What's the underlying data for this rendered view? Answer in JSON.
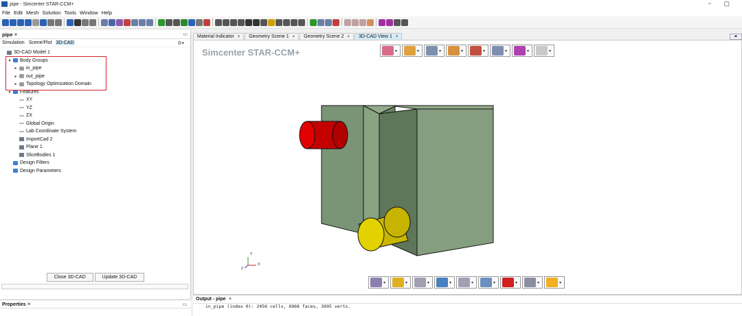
{
  "window": {
    "title": "pipe - Simcenter STAR-CCM+",
    "min_glyph": "−",
    "max_glyph": "▢"
  },
  "menu": [
    "File",
    "Edit",
    "Mesh",
    "Solution",
    "Tools",
    "Window",
    "Help"
  ],
  "left_panel": {
    "title": "pipe",
    "close": "×",
    "tabs": [
      "Simulation",
      "Scene/Plot",
      "3D-CAD"
    ],
    "active_tab": "3D-CAD",
    "tree": [
      {
        "label": "3D-CAD Model 1",
        "level": 0,
        "icon": "cad-model-icon",
        "arrow": ""
      },
      {
        "label": "Body Groups",
        "level": 1,
        "icon": "folder-icon",
        "arrow": "▾"
      },
      {
        "label": "in_pipe",
        "level": 2,
        "icon": "body-icon",
        "arrow": "▸"
      },
      {
        "label": "out_pipe",
        "level": 2,
        "icon": "body-icon",
        "arrow": "▸"
      },
      {
        "label": "Topology Optimization Domain",
        "level": 2,
        "icon": "body-icon",
        "arrow": "▸"
      },
      {
        "label": "Features",
        "level": 1,
        "icon": "folder-icon",
        "arrow": "▾"
      },
      {
        "label": "XY",
        "level": 2,
        "icon": "plane-icon",
        "arrow": ""
      },
      {
        "label": "YZ",
        "level": 2,
        "icon": "plane-icon",
        "arrow": ""
      },
      {
        "label": "ZX",
        "level": 2,
        "icon": "plane-icon",
        "arrow": ""
      },
      {
        "label": "Global Origin",
        "level": 2,
        "icon": "origin-icon",
        "arrow": ""
      },
      {
        "label": "Lab Coordinate System",
        "level": 2,
        "icon": "coordsys-icon",
        "arrow": ""
      },
      {
        "label": "ImportCad 2",
        "level": 2,
        "icon": "import-icon",
        "arrow": ""
      },
      {
        "label": "Plane 1",
        "level": 2,
        "icon": "sketch-plane-icon",
        "arrow": ""
      },
      {
        "label": "SliceBodies 1",
        "level": 2,
        "icon": "slice-icon",
        "arrow": ""
      },
      {
        "label": "Design Filters",
        "level": 1,
        "icon": "folder-icon",
        "arrow": ""
      },
      {
        "label": "Design Parameters",
        "level": 1,
        "icon": "folder-icon",
        "arrow": ""
      }
    ],
    "buttons": {
      "close": "Close 3D-CAD",
      "update": "Update 3D-CAD"
    }
  },
  "properties": {
    "title": "Properties",
    "close": "×"
  },
  "view_tabs": [
    {
      "label": "Material Indicator",
      "close": "×"
    },
    {
      "label": "Geometry Scene 1",
      "close": "×"
    },
    {
      "label": "Geometry Scene 2",
      "close": "×"
    },
    {
      "label": "3D-CAD View 1",
      "close": "×"
    }
  ],
  "active_view_tab": "3D-CAD View 1",
  "viewport": {
    "brand": "Simcenter STAR-CCM+",
    "axis_y": "Y",
    "axis_x": "X",
    "axis_z": "Z"
  },
  "output": {
    "title": "Output - pipe",
    "close": "×",
    "line1": "in_pipe (index 0): 2456 cells, 6968 faces, 3095 verts."
  },
  "colors": {
    "pipe_in": "#d40000",
    "pipe_out": "#d6c400",
    "domain": "#7e9a79"
  }
}
